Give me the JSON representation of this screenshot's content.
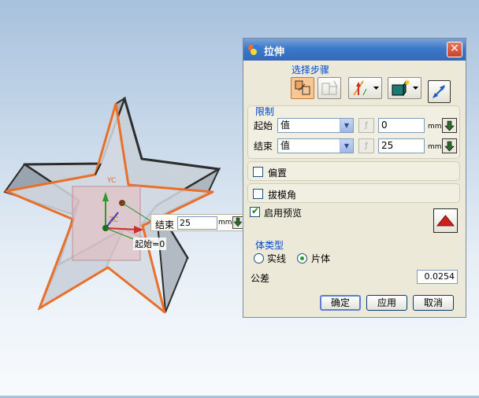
{
  "dialog": {
    "title": "拉伸",
    "close_glyph": "✕",
    "selection_steps": {
      "title": "选择步骤",
      "tools": [
        "section-select-icon",
        "direction-disabled-icon",
        "vector-icon",
        "body-type-icon",
        "reverse-direction-icon"
      ]
    },
    "limits": {
      "title": "限制",
      "start": {
        "label": "起始",
        "option": "值",
        "value": "0",
        "unit": "mm"
      },
      "end": {
        "label": "结束",
        "option": "值",
        "value": "25",
        "unit": "mm"
      }
    },
    "offset": {
      "label": "偏置",
      "checked": false
    },
    "draft": {
      "label": "拔模角",
      "checked": false
    },
    "preview": {
      "label": "启用预览",
      "checked": true
    },
    "body_type": {
      "title": "体类型",
      "options": [
        "实线",
        "片体"
      ],
      "selected": "片体"
    },
    "tolerance": {
      "label": "公差",
      "value": "0.0254"
    },
    "buttons": {
      "ok": "确定",
      "apply": "应用",
      "cancel": "取消"
    }
  },
  "canvas": {
    "end_label": "结束",
    "end_value": "25",
    "end_unit": "mm",
    "start_label": "起始=0",
    "axis_yc": "YC",
    "axis_zc": "ZC"
  },
  "colors": {
    "accent_orange": "#e8702a",
    "titlebar_blue": "#3d78c9",
    "group_title": "#0046d5",
    "preview_red": "#cc1f1f"
  }
}
